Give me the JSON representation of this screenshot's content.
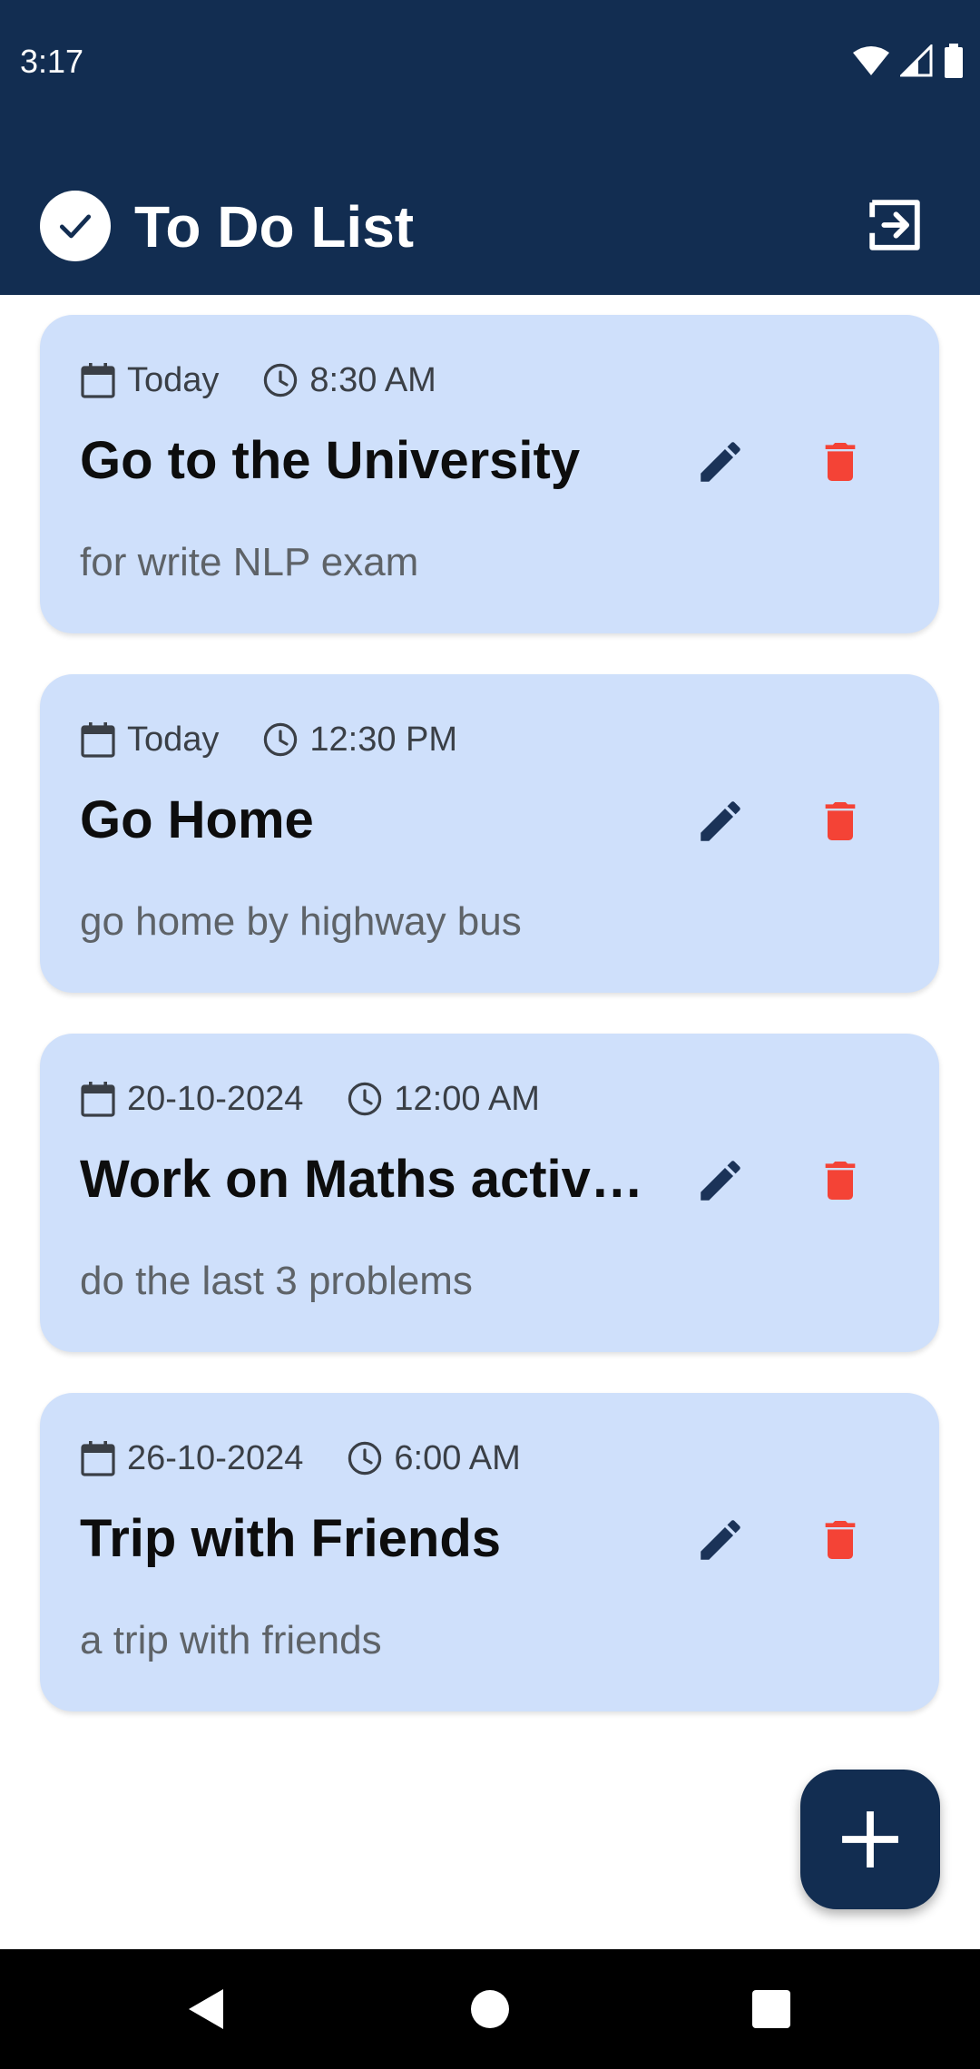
{
  "status_bar": {
    "time": "3:17",
    "icons": [
      "wifi-icon",
      "signal-icon",
      "battery-icon"
    ]
  },
  "app_bar": {
    "title": "To Do List",
    "logo_icon": "check-circle-icon",
    "action_icon": "logout-icon",
    "background": "#122d51"
  },
  "tasks": [
    {
      "date": "Today",
      "time": "8:30 AM",
      "title": "Go to the University",
      "description": "for write NLP exam"
    },
    {
      "date": "Today",
      "time": "12:30 PM",
      "title": "Go Home",
      "description": "go home by highway bus"
    },
    {
      "date": "20-10-2024",
      "time": "12:00 AM",
      "title": "Work on Maths activ…",
      "description": "do the last 3 problems"
    },
    {
      "date": "26-10-2024",
      "time": "6:00 AM",
      "title": "Trip with Friends",
      "description": "a trip  with friends"
    }
  ],
  "card_icons": {
    "date": "calendar-icon",
    "time": "clock-icon",
    "edit": "pencil-icon",
    "delete": "trash-icon"
  },
  "fab": {
    "icon": "plus-icon"
  },
  "colors": {
    "primary": "#122d51",
    "card_background": "#cfe0fb",
    "delete": "#f44336",
    "edit": "#1b3358"
  },
  "nav_bar": {
    "icons": [
      "back-icon",
      "home-icon",
      "recents-icon"
    ]
  }
}
